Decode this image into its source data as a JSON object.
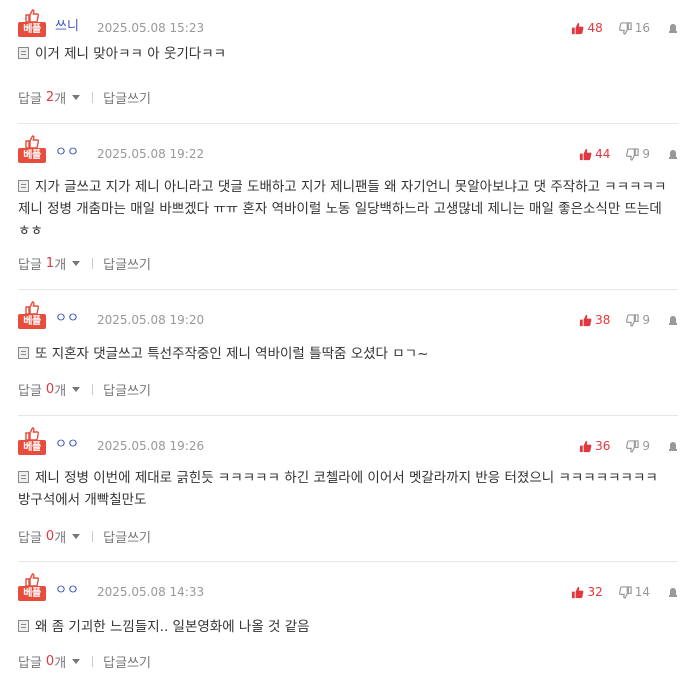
{
  "labels": {
    "best_tag": "베플",
    "reply": "답글",
    "reply_unit": "개",
    "write_reply": "답글쓰기"
  },
  "icons": {
    "best": "thumbs-up-icon",
    "upvote": "thumbs-up-icon",
    "downvote": "thumbs-down-icon",
    "report": "report-icon",
    "document": "document-icon"
  },
  "colors": {
    "best_badge": "#e74c3c",
    "upvote": "#e0383e",
    "nickname": "#3a57b7"
  },
  "comments": [
    {
      "nickname": "쓰니",
      "date": "2025.05.08 15:23",
      "up": "48",
      "down": "16",
      "text": "이거 제니 맞아ㅋㅋ 아 웃기다ㅋㅋ",
      "replies": "2"
    },
    {
      "nickname": "ㅇㅇ",
      "date": "2025.05.08 19:22",
      "up": "44",
      "down": "9",
      "text": "지가 글쓰고 지가 제니 아니라고 댓글 도배하고 지가 제니팬들 왜 자기언니 못알아보냐고 댓 주작하고 ㅋㅋㅋㅋㅋ 제니 정병 개춤마는 매일 바쁘겠다 ㅠㅠ 혼자 역바이럴 노동 일당백하느라 고생많네 제니는 매일 좋은소식만 뜨는데 ㅎㅎ",
      "replies": "1"
    },
    {
      "nickname": "ㅇㅇ",
      "date": "2025.05.08 19:20",
      "up": "38",
      "down": "9",
      "text": "또 지혼자 댓글쓰고 특선주작중인 제니 역바이럴 틀딱줌 오셨다 ㅁㄱ~",
      "replies": "0"
    },
    {
      "nickname": "ㅇㅇ",
      "date": "2025.05.08 19:26",
      "up": "36",
      "down": "9",
      "text": "제니 정병 이번에 제대로 긁힌듯 ㅋㅋㅋㅋㅋ 하긴 코첼라에 이어서 멧갈라까지 반응 터졌으니 ㅋㅋㅋㅋㅋㅋㅋㅋ 방구석에서 개빡칠만도",
      "replies": "0"
    },
    {
      "nickname": "ㅇㅇ",
      "date": "2025.05.08 14:33",
      "up": "32",
      "down": "14",
      "text": "왜 좀 기괴한 느낌들지.. 일본영화에 나올 것 같음",
      "replies": "0"
    }
  ]
}
